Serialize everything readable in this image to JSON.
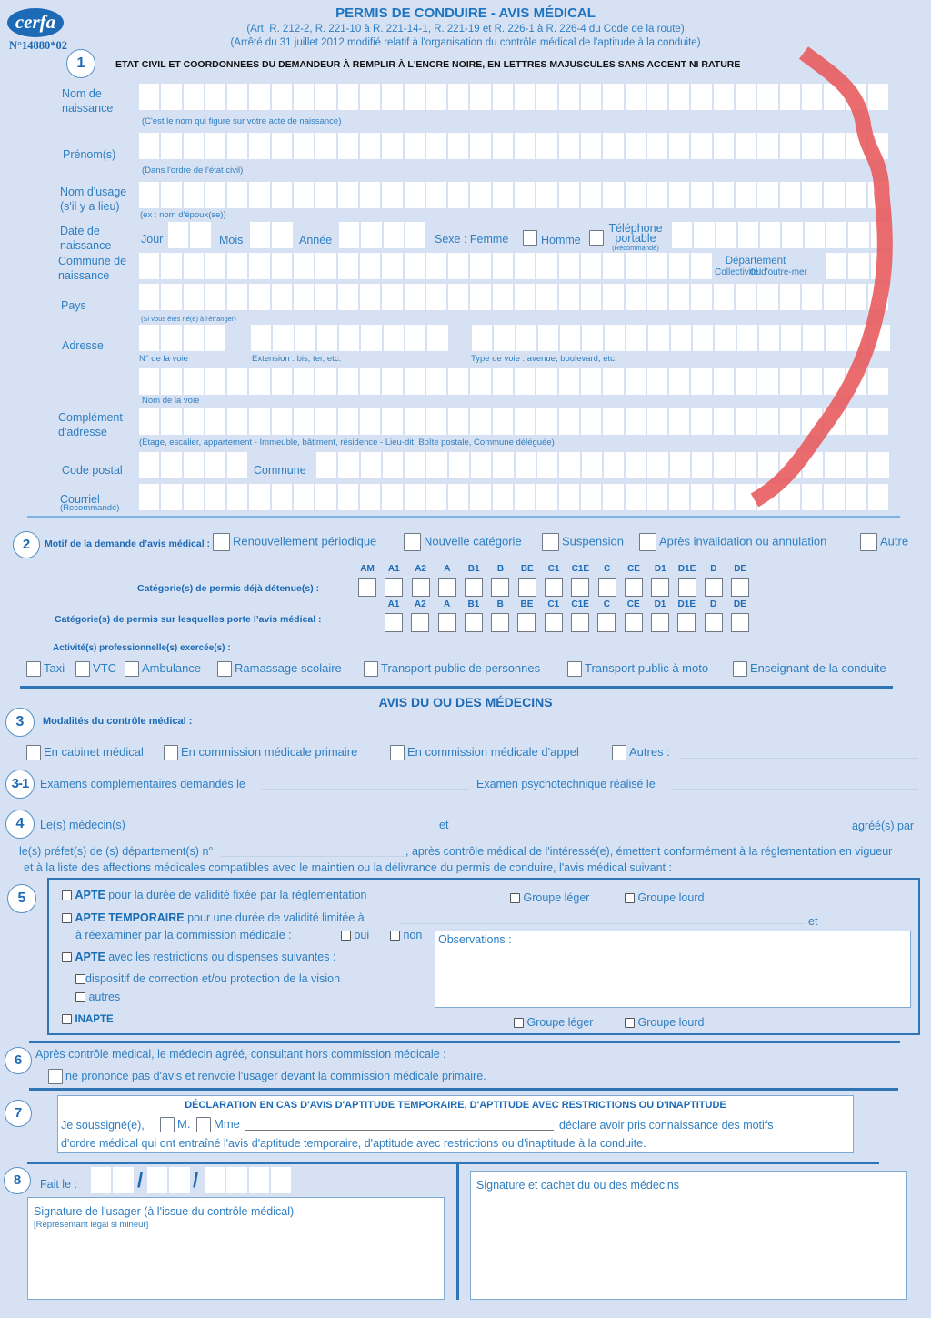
{
  "header": {
    "logo_text": "cerfa",
    "cerfa_number": "N°14880*02",
    "title": "PERMIS DE CONDUIRE - AVIS MÉDICAL",
    "subtitle_1": "(Art. R. 212-2, R. 221-10 à R. 221-14-1, R. 221-19 et R. 226-1 à R. 226-4 du Code de la route)",
    "subtitle_2": "(Arrêté du 31 juillet 2012 modifié relatif à l'organisation du contrôle médical de l'aptitude à la conduite)"
  },
  "section1": {
    "number": "1",
    "heading": "ETAT CIVIL ET COORDONNEES DU DEMANDEUR À REMPLIR À L'ENCRE NOIRE, EN LETTRES  MAJUSCULES SANS ACCENT NI RATURE",
    "nom_naissance_label": "Nom de naissance",
    "nom_naissance_hint": "(C'est le nom qui figure sur votre acte de naissance)",
    "prenoms_label": "Prénom(s)",
    "prenoms_hint": "(Dans l'ordre de l'état civil)",
    "nom_usage_label": "Nom d'usage (s'il y a lieu)",
    "nom_usage_hint": "(ex : nom d'époux(se))",
    "date_naissance_label": "Date de naissance",
    "jour_label": "Jour",
    "mois_label": "Mois",
    "annee_label": "Année",
    "sexe_label": "Sexe : Femme",
    "homme_label": "Homme",
    "telephone_label": "Téléphone portable",
    "telephone_hint": "(Recommandé)",
    "commune_naissance_label": "Commune de naissance",
    "departement_label": "Département ou",
    "collectivite_label": "Collectivité d'outre-mer",
    "pays_label": "Pays",
    "pays_hint": "(Si vous êtes né(e) à l'étranger)",
    "adresse_label": "Adresse",
    "num_voie_hint": "N° de la voie",
    "extension_hint": "Extension : bis, ter, etc.",
    "type_voie_hint": "Type de voie : avenue, boulevard, etc.",
    "nom_voie_hint": "Nom de la voie",
    "complement_label": "Complément d'adresse",
    "complement_hint": "(Étage, escalier, appartement - Immeuble, bâtiment, résidence - Lieu-dit, Boîte postale, Commune déléguée)",
    "code_postal_label": "Code postal",
    "commune_label": "Commune",
    "courriel_label": "Courriel",
    "courriel_hint": "(Recommandé)"
  },
  "section2": {
    "number": "2",
    "motif_label": "Motif de la demande d’avis médical :",
    "motifs": [
      "Renouvellement périodique",
      "Nouvelle catégorie",
      "Suspension",
      "Après invalidation ou annulation",
      "Autre"
    ],
    "categories_detenues_label": "Catégorie(s) de permis déjà détenue(s) :",
    "categories_detenues": [
      "AM",
      "A1",
      "A2",
      "A",
      "B1",
      "B",
      "BE",
      "C1",
      "C1E",
      "C",
      "CE",
      "D1",
      "D1E",
      "D",
      "DE"
    ],
    "categories_avis_label": "Catégorie(s) de permis sur lesquelles porte l’avis médical :",
    "categories_avis": [
      "A1",
      "A2",
      "A",
      "B1",
      "B",
      "BE",
      "C1",
      "C1E",
      "C",
      "CE",
      "D1",
      "D1E",
      "D",
      "DE"
    ],
    "activites_label": "Activité(s) professionnelle(s) exercée(s) :",
    "activites": [
      "Taxi",
      "VTC",
      "Ambulance",
      "Ramassage scolaire",
      "Transport public de personnes",
      "Transport public à moto",
      "Enseignant de la conduite"
    ]
  },
  "avis_heading": "AVIS DU OU DES MÉDECINS",
  "section3": {
    "number": "3",
    "label": "Modalités du contrôle médical :",
    "options": [
      "En cabinet médical",
      "En commission médicale primaire",
      "En commission médicale d'appel",
      "Autres :"
    ]
  },
  "section3_1": {
    "number": "3-1",
    "examens_label": "Examens complémentaires demandés le",
    "psycho_label": "Examen psychotechnique réalisé le"
  },
  "section4": {
    "number": "4",
    "medecins_label": "Le(s) médecin(s)",
    "et_label": "et",
    "agrees_label": "agréé(s) par",
    "line2": "le(s) préfet(s) de (s) département(s) n°",
    "line2_suffix": ", après contrôle médical de l'intéressé(e), émettent conformément à la réglementation en vigueur",
    "line3": "et à la liste des affections médicales compatibles avec le maintien ou la délivrance du permis de conduire, l'avis médical suivant :"
  },
  "section5": {
    "number": "5",
    "apte_bold": "APTE",
    "apte_text": " pour la durée de validité fixée par la réglementation",
    "apte_temp_bold": "APTE TEMPORAIRE",
    "apte_temp_text": " pour une durée de validité limitée à",
    "reexaminer_text": "à réexaminer par la commission médicale :",
    "oui_label": "oui",
    "non_label": "non",
    "et_label": "et",
    "apte_restr_bold": "APTE",
    "apte_restr_text": " avec les restrictions ou dispenses suivantes :",
    "vision_label": "dispositif de correction et/ou protection de la vision",
    "autres_label": "autres",
    "inapte_label": "INAPTE",
    "groupe_leger": "Groupe léger",
    "groupe_lourd": "Groupe lourd",
    "observations_label": "Observations :"
  },
  "section6": {
    "number": "6",
    "text": "Après contrôle médical, le médecin agréé, consultant hors commission médicale :",
    "option": "ne prononce pas d'avis et renvoie l'usager devant la commission médicale primaire."
  },
  "section7": {
    "number": "7",
    "heading": "DÉCLARATION EN CAS D'AVIS D'APTITUDE TEMPORAIRE, D'APTITUDE AVEC RESTRICTIONS OU D'INAPTITUDE",
    "soussigne": "Je soussigné(e),",
    "m_label": "M.",
    "mme_label": "Mme",
    "declare": "déclare avoir pris connaissance des motifs",
    "line2": "d'ordre médical qui ont entraîné l'avis d'aptitude temporaire, d'aptitude avec restrictions ou d'inaptitude à la conduite."
  },
  "section8": {
    "number": "8",
    "fait_le": "Fait le :",
    "slash": "/",
    "signature_usager": "Signature de l'usager (à l'issue du contrôle médical)",
    "representant": "[Représentant légal si mineur]",
    "signature_medecins": "Signature et cachet du ou des médecins"
  },
  "annotation": {
    "color": "#e8585a"
  }
}
